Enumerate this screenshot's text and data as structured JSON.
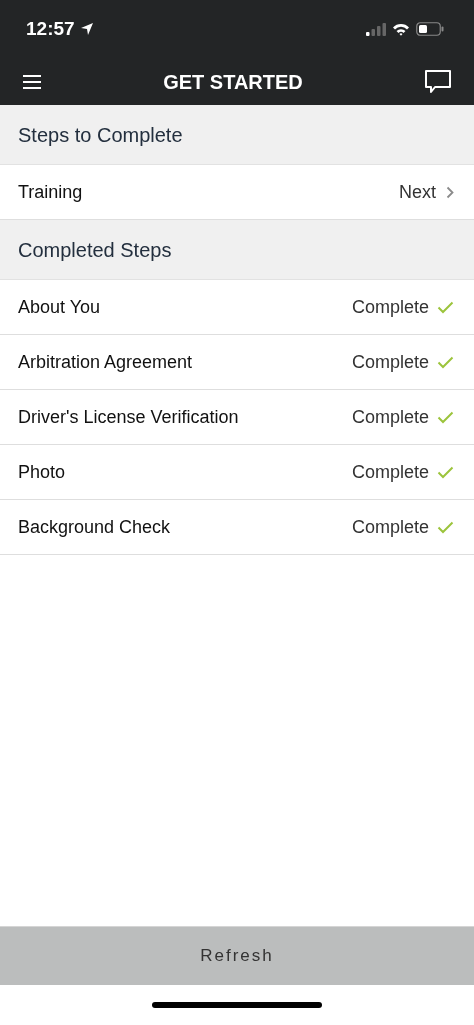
{
  "status_bar": {
    "time": "12:57"
  },
  "nav": {
    "title": "GET STARTED"
  },
  "sections": [
    {
      "title": "Steps to Complete",
      "rows": [
        {
          "label": "Training",
          "status": "Next",
          "kind": "next"
        }
      ]
    },
    {
      "title": "Completed Steps",
      "rows": [
        {
          "label": "About You",
          "status": "Complete",
          "kind": "complete"
        },
        {
          "label": "Arbitration Agreement",
          "status": "Complete",
          "kind": "complete"
        },
        {
          "label": "Driver's License Verification",
          "status": "Complete",
          "kind": "complete"
        },
        {
          "label": "Photo",
          "status": "Complete",
          "kind": "complete"
        },
        {
          "label": "Background Check",
          "status": "Complete",
          "kind": "complete"
        }
      ]
    }
  ],
  "refresh_button": "Refresh"
}
